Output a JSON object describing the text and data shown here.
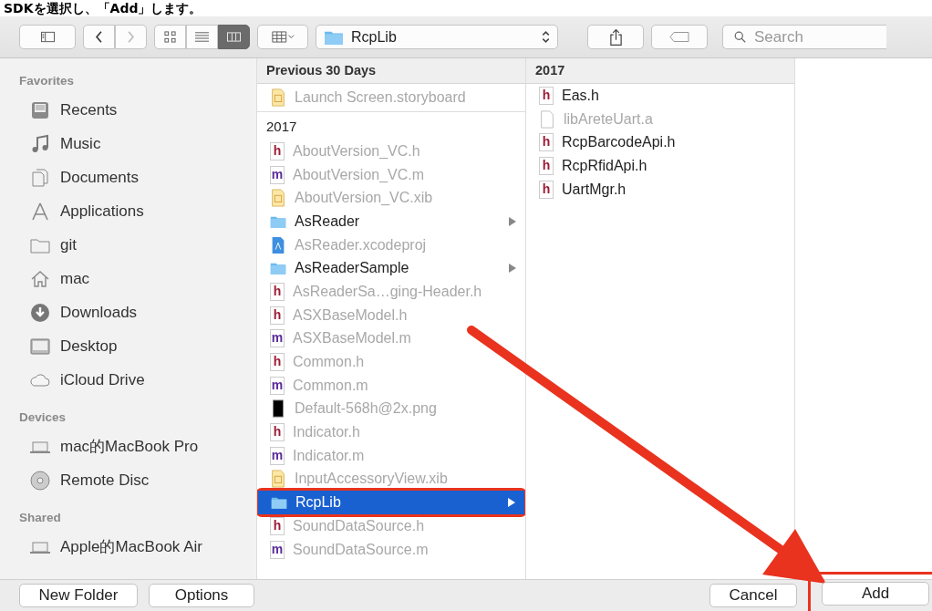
{
  "caption": "SDKを選択し、「Add」します。",
  "toolbar": {
    "back_disabled": false,
    "forward_disabled": true,
    "view_modes": [
      {
        "kind": "icons",
        "selected": false
      },
      {
        "kind": "list",
        "selected": false
      },
      {
        "kind": "columns",
        "selected": true
      }
    ],
    "path": "RcpLib",
    "search": {
      "placeholder": "Search"
    }
  },
  "sidebar": [
    {
      "heading": "Favorites",
      "items": [
        {
          "label": "Recents",
          "kind": "recents"
        },
        {
          "label": "Music",
          "kind": "music"
        },
        {
          "label": "Documents",
          "kind": "documents"
        },
        {
          "label": "Applications",
          "kind": "applications"
        },
        {
          "label": "git",
          "kind": "folder"
        },
        {
          "label": "mac",
          "kind": "home"
        },
        {
          "label": "Downloads",
          "kind": "downloads"
        },
        {
          "label": "Desktop",
          "kind": "desktop"
        },
        {
          "label": "iCloud Drive",
          "kind": "cloud"
        }
      ]
    },
    {
      "heading": "Devices",
      "items": [
        {
          "label": "mac的MacBook Pro",
          "kind": "laptop"
        },
        {
          "label": "Remote Disc",
          "kind": "disc"
        }
      ]
    },
    {
      "heading": "Shared",
      "items": [
        {
          "label": "Apple的MacBook Air",
          "kind": "laptop"
        }
      ]
    }
  ],
  "columns": [
    {
      "header": "Previous 30 Days",
      "items": [
        {
          "kind": "storyboard",
          "name": "Launch Screen.storyboard",
          "dim": true,
          "selected": false,
          "annotated": false
        },
        {
          "kind": "group",
          "name": "2017"
        },
        {
          "kind": "header",
          "badge": "h",
          "name": "AboutVersion_VC.h",
          "dim": true,
          "selected": false,
          "annotated": false
        },
        {
          "kind": "source",
          "badge": "m",
          "name": "AboutVersion_VC.m",
          "dim": true,
          "selected": false,
          "annotated": false
        },
        {
          "kind": "xib",
          "name": "AboutVersion_VC.xib",
          "dim": true,
          "selected": false,
          "annotated": false
        },
        {
          "kind": "folder",
          "name": "AsReader",
          "dim": false,
          "selected": false,
          "annotated": false
        },
        {
          "kind": "project",
          "name": "AsReader.xcodeproj",
          "dim": true,
          "selected": false,
          "annotated": false
        },
        {
          "kind": "folder",
          "name": "AsReaderSample",
          "dim": false,
          "selected": false,
          "annotated": false
        },
        {
          "kind": "header",
          "badge": "h",
          "name": "AsReaderSa…ging-Header.h",
          "dim": true,
          "selected": false,
          "annotated": false
        },
        {
          "kind": "header",
          "badge": "h",
          "name": "ASXBaseModel.h",
          "dim": true,
          "selected": false,
          "annotated": false
        },
        {
          "kind": "source",
          "badge": "m",
          "name": "ASXBaseModel.m",
          "dim": true,
          "selected": false,
          "annotated": false
        },
        {
          "kind": "header",
          "badge": "h",
          "name": "Common.h",
          "dim": true,
          "selected": false,
          "annotated": false
        },
        {
          "kind": "source",
          "badge": "m",
          "name": "Common.m",
          "dim": true,
          "selected": false,
          "annotated": false
        },
        {
          "kind": "image",
          "name": "Default-568h@2x.png",
          "dim": true,
          "selected": false,
          "annotated": false
        },
        {
          "kind": "header",
          "badge": "h",
          "name": "Indicator.h",
          "dim": true,
          "selected": false,
          "annotated": false
        },
        {
          "kind": "source",
          "badge": "m",
          "name": "Indicator.m",
          "dim": true,
          "selected": false,
          "annotated": false
        },
        {
          "kind": "xib",
          "name": "InputAccessoryView.xib",
          "dim": true,
          "selected": false,
          "annotated": false
        },
        {
          "kind": "folder",
          "name": "RcpLib",
          "dim": false,
          "selected": true,
          "annotated": true
        },
        {
          "kind": "header",
          "badge": "h",
          "name": "SoundDataSource.h",
          "dim": true,
          "selected": false,
          "annotated": false
        },
        {
          "kind": "source",
          "badge": "m",
          "name": "SoundDataSource.m",
          "dim": true,
          "selected": false,
          "annotated": false
        }
      ]
    },
    {
      "header": "2017",
      "items": [
        {
          "kind": "header",
          "badge": "h",
          "name": "Eas.h",
          "dim": false,
          "selected": false,
          "annotated": false
        },
        {
          "kind": "file",
          "name": "libAreteUart.a",
          "dim": true,
          "selected": false,
          "annotated": false
        },
        {
          "kind": "header",
          "badge": "h",
          "name": "RcpBarcodeApi.h",
          "dim": false,
          "selected": false,
          "annotated": false
        },
        {
          "kind": "header",
          "badge": "h",
          "name": "RcpRfidApi.h",
          "dim": false,
          "selected": false,
          "annotated": false
        },
        {
          "kind": "header",
          "badge": "h",
          "name": "UartMgr.h",
          "dim": false,
          "selected": false,
          "annotated": false
        }
      ]
    }
  ],
  "buttons": [
    {
      "label": "New Folder"
    },
    {
      "label": "Options"
    }
  ],
  "actions": [
    {
      "label": "Cancel",
      "annotated": false
    },
    {
      "label": "Add",
      "annotated": true
    }
  ]
}
